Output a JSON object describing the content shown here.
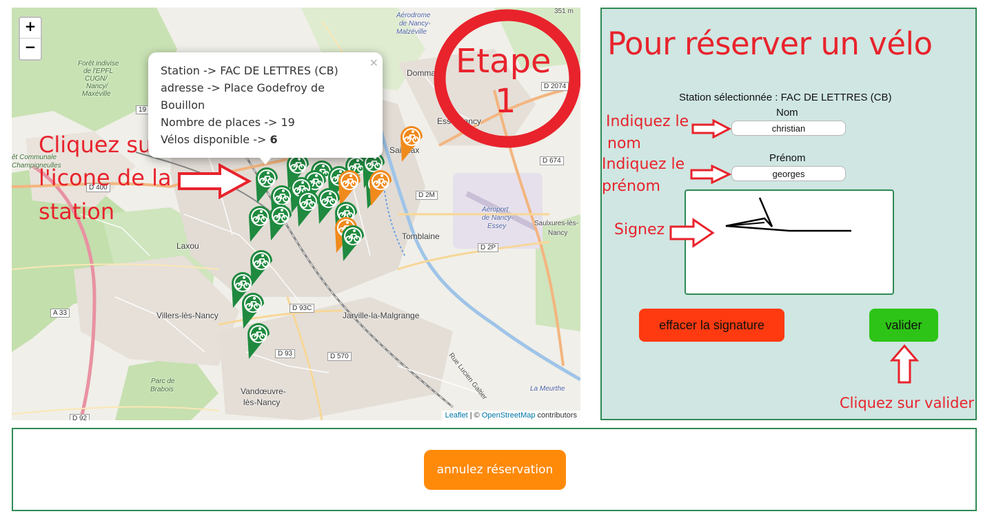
{
  "map": {
    "zoom_in": "+",
    "zoom_out": "−",
    "popup": {
      "close": "×",
      "station_line": "Station -> FAC DE LETTRES (CB)",
      "address_line": "adresse -> Place Godefroy de Bouillon",
      "places_line": "Nombre de places -> 19",
      "bikes_prefix": "Vélos disponible -> ",
      "bikes_value": "6"
    },
    "overlay": {
      "etape_word": "Etape",
      "etape_number": "1",
      "click_icon_line1": "Cliquez sur",
      "click_icon_line2": "l'icone de la",
      "click_icon_line3": "station"
    },
    "places": {
      "laxou": "Laxou",
      "villers": "Villers-lès-Nancy",
      "vandoeuvre1": "Vandœuvre-",
      "vandoeuvre2": "lès-Nancy",
      "jarville": "Jarville-la-Malgrange",
      "tomblaine": "Tomblaine",
      "saulxures1": "Saulxures-lès-",
      "saulxures2": "Nancy",
      "dommartemont": "Dommar",
      "essey": "Esse  Nancy",
      "saint_max": "Sai  Max",
      "aerodrome1": "Aérodrome",
      "aerodrome2": "de Nancy-",
      "aerodrome3": "Malzéville",
      "aeroport1": "Aéroport",
      "aeroport2": "de Nancy-",
      "aeroport3": "Essey",
      "foret1": "Forêt indivise",
      "foret2": "de l'EPFL",
      "foret3": "CUGN/",
      "foret4": "Nancy/",
      "foret5": "Maxéville",
      "champigneulles1": "êt Communale",
      "champigneulles2": "Champigneulles",
      "parc1": "Parc de",
      "parc2": "Brabois",
      "altitude": "351 m",
      "rue_lucien": "Rue Lucien Galtier",
      "meurthe": "La Meurthe"
    },
    "roads": {
      "d2074": "D 2074",
      "d674": "D 674",
      "d400": "D 400",
      "d2m": "D 2M",
      "d2p": "D 2P",
      "d93c": "D 93C",
      "d93": "D 93",
      "d570": "D 570",
      "a33": "A 33",
      "d92": "D 92",
      "r19": "19"
    },
    "attribution": {
      "leaflet": "Leaflet",
      "sep": " | © ",
      "osm": "OpenStreetMap",
      "contrib": " contributors"
    },
    "colors": {
      "marker_green": "#1f8a3f",
      "marker_orange": "#f08a1c",
      "accent_red": "#e8232c"
    }
  },
  "panel": {
    "title": "Pour réserver un vélo",
    "selected_station": "Station sélectionnée : FAC DE LETTRES (CB)",
    "nom_label": "Nom",
    "nom_value": "christian",
    "prenom_label": "Prénom",
    "prenom_value": "georges",
    "instr_nom_1": "Indiquez le",
    "instr_nom_2": "nom",
    "instr_prenom_1": "Indiquez le",
    "instr_prenom_2": "prénom",
    "instr_sign": "Signez",
    "clear_button": "effacer la signature",
    "validate_button": "valider",
    "instr_validate": "Cliquez sur valider"
  },
  "bottom": {
    "cancel_button": "annulez réservation"
  }
}
